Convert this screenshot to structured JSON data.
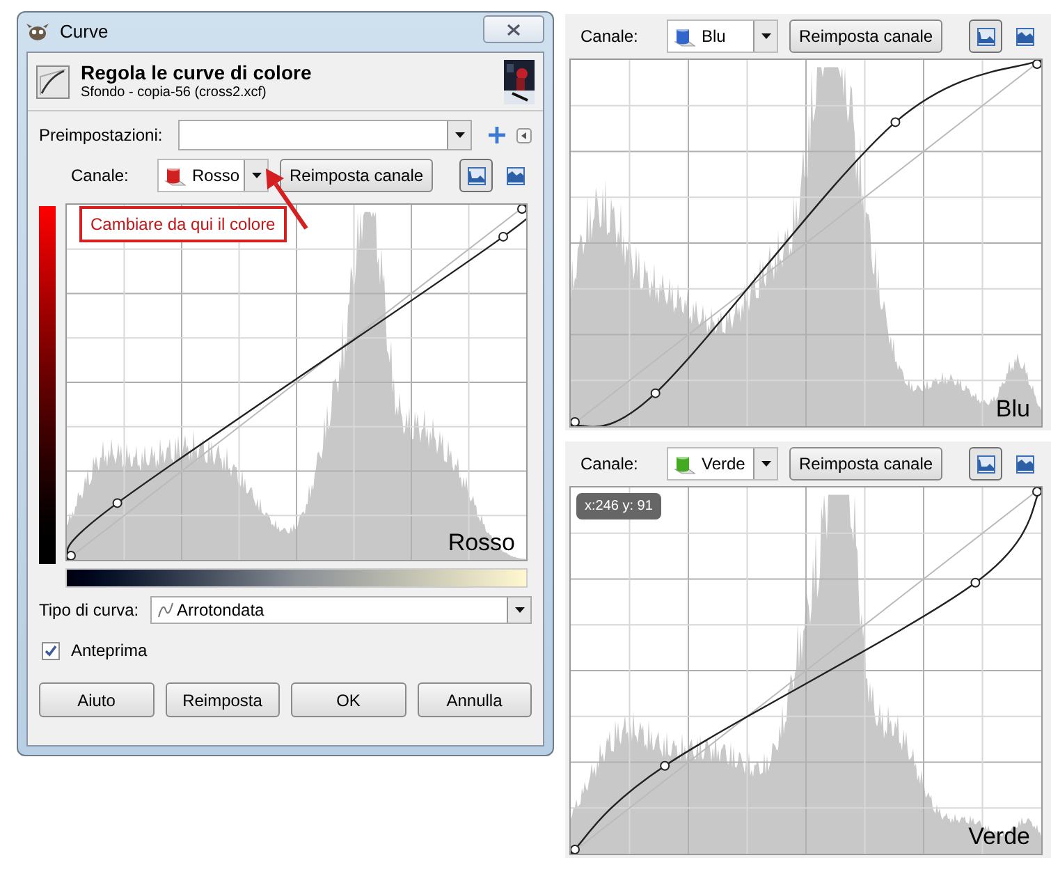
{
  "dialog": {
    "title": "Curve",
    "header": {
      "title": "Regola le curve di colore",
      "subtitle": "Sfondo - copia-56 (cross2.xcf)"
    },
    "presets_label": "Preimpostazioni:",
    "channel": {
      "label": "Canale:",
      "value": "Rosso",
      "color": "#d02020",
      "reset": "Reimposta canale",
      "linear_selected": true,
      "graph_label": "Rosso"
    },
    "annotation": "Cambiare da qui il colore",
    "curve_type_label": "Tipo di curva:",
    "curve_type": "Arrotondata",
    "preview": {
      "label": "Anteprima",
      "checked": true
    },
    "buttons": [
      "Aiuto",
      "Reimposta",
      "OK",
      "Annulla"
    ]
  },
  "panels": [
    {
      "label": "Canale:",
      "value": "Blu",
      "color": "#3366cc",
      "reset": "Reimposta canale",
      "linear_selected": true,
      "graph_label": "Blu"
    },
    {
      "label": "Canale:",
      "value": "Verde",
      "color": "#44aa22",
      "reset": "Reimposta canale",
      "linear_selected": true,
      "graph_label": "Verde",
      "tooltip": "x:246 y: 91"
    }
  ]
}
